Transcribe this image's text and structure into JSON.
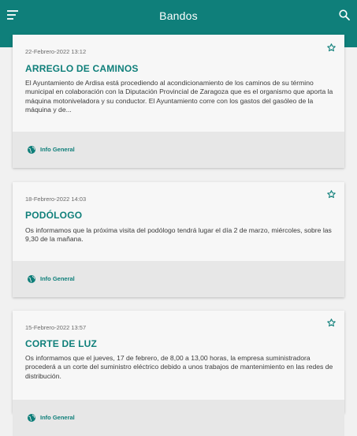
{
  "appbar": {
    "title": "Bandos",
    "menu_icon": "menu-icon",
    "search_icon": "search-icon",
    "background": "#0f7f7a"
  },
  "bandos": [
    {
      "date": "22-Febrero-2022 13:12",
      "title": "ARREGLO DE CAMINOS",
      "excerpt": "El Ayuntamiento de Ardisa está procediendo al acondicionamiento de los caminos de su término municipal en colaboración con la Diputación Provincial de Zaragoza que es el organismo que aporta la máquina motoniveladora y su conductor. El Ayuntamiento corre con los gastos del gasóleo de la máquina y de...",
      "category": "Info General",
      "favorite_icon": "star-outline-icon",
      "category_icon": "globe-icon"
    },
    {
      "date": "18-Febrero-2022 14:03",
      "title": "PODÓLOGO",
      "excerpt": "Os informamos que la próxima visita del podólogo tendrá lugar el día 2 de marzo, miércoles, sobre las 9,30 de la mañana.",
      "category": "Info General",
      "favorite_icon": "star-outline-icon",
      "category_icon": "globe-icon"
    },
    {
      "date": "15-Febrero-2022 13:57",
      "title": "CORTE DE LUZ",
      "excerpt": "Os informamos que el jueves, 17 de febrero, de 8,00 a 13,00 horas,  la empresa suministradora procederá a un corte del suministro eléctrico debido a unos trabajos de  mantenimiento en las redes de distribución.",
      "category": "Info General",
      "favorite_icon": "star-outline-icon",
      "category_icon": "globe-icon"
    }
  ]
}
